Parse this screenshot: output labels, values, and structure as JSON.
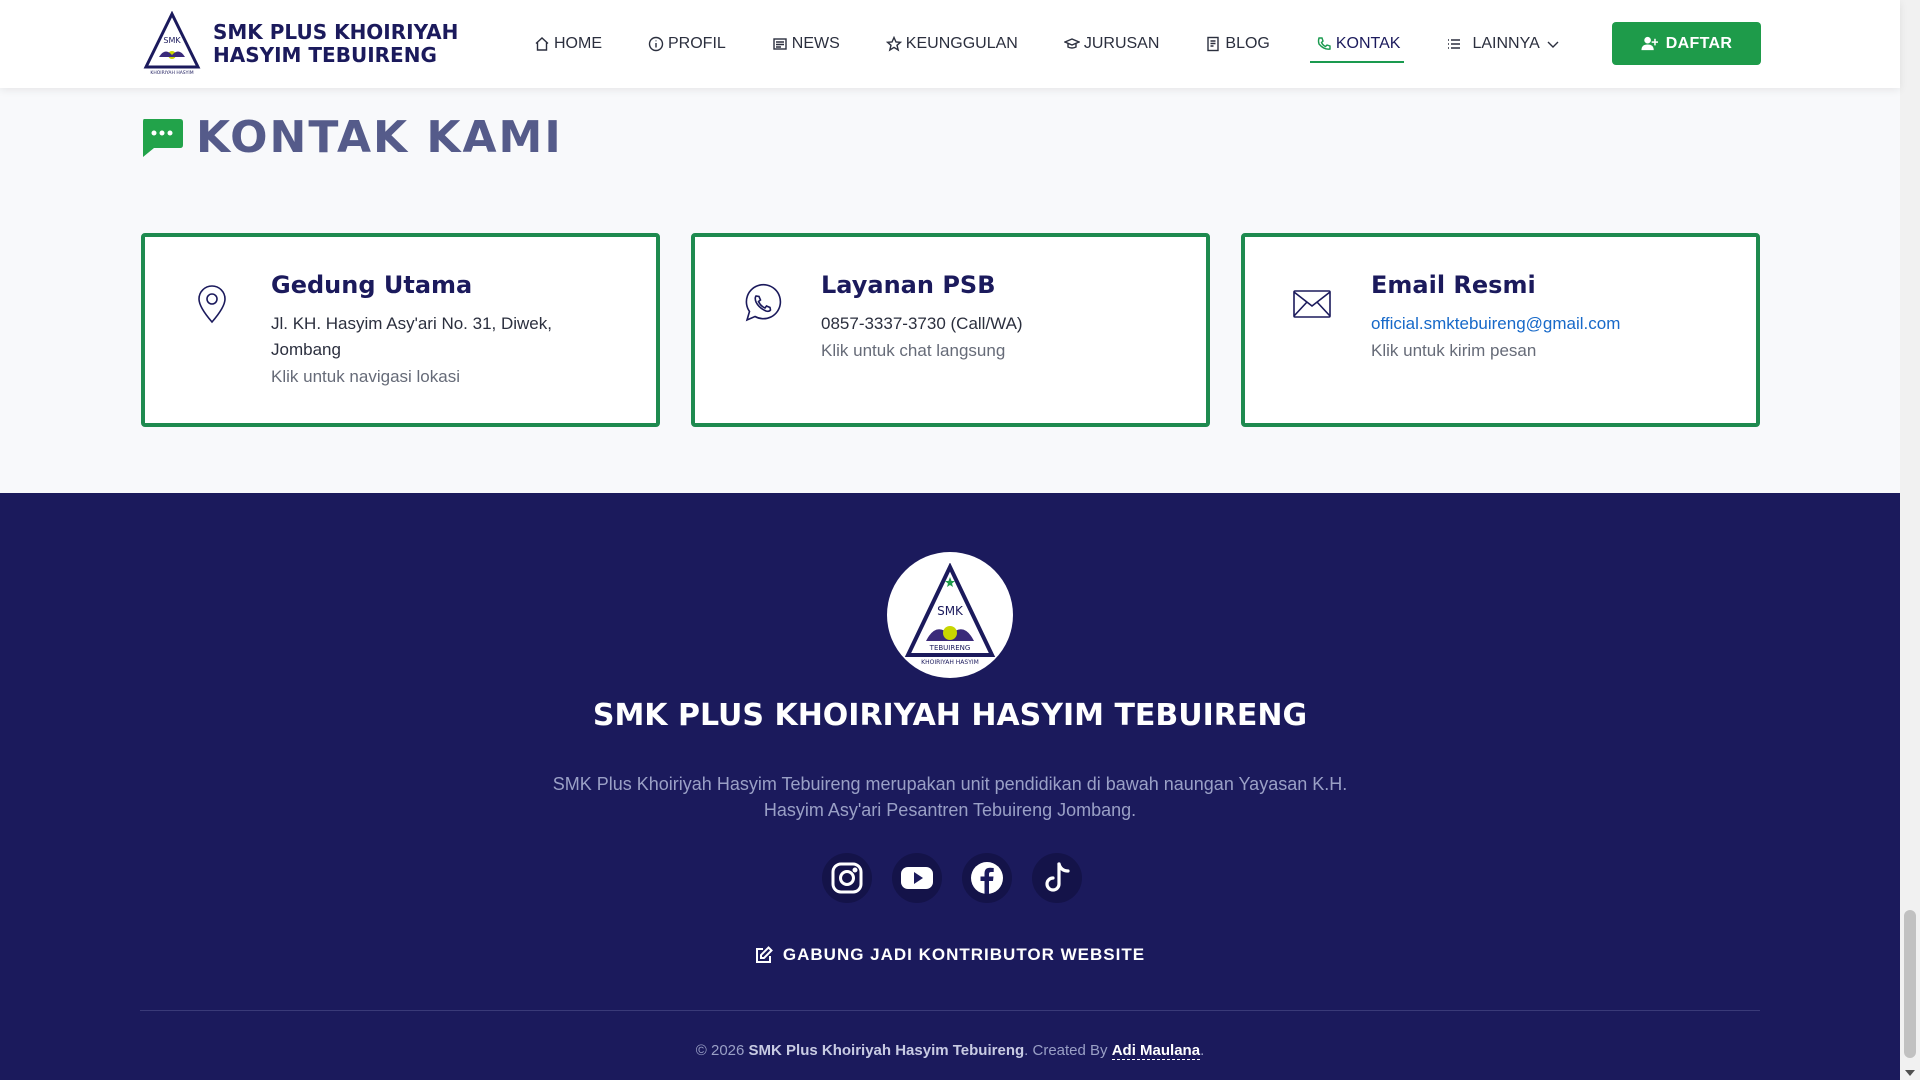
{
  "brand": {
    "name": "SMK PLUS KHOIRIYAH HASYIM TEBUIRENG"
  },
  "nav": {
    "items": [
      {
        "label": "HOME",
        "icon": "home-icon"
      },
      {
        "label": "PROFIL",
        "icon": "info-icon"
      },
      {
        "label": "NEWS",
        "icon": "newspaper-icon"
      },
      {
        "label": "KEUNGGULAN",
        "icon": "star-icon"
      },
      {
        "label": "JURUSAN",
        "icon": "mortarboard-icon"
      },
      {
        "label": "BLOG",
        "icon": "document-icon"
      },
      {
        "label": "KONTAK",
        "icon": "phone-icon",
        "active": true
      },
      {
        "label": "LAINNYA",
        "icon": "list-icon"
      }
    ],
    "cta_label": "DAFTAR"
  },
  "contact": {
    "title": "KONTAK KAMI",
    "cards": [
      {
        "title": "Gedung Utama",
        "detail": "Jl. KH. Hasyim Asy'ari No. 31, Diwek, Jombang",
        "hint": "Klik untuk navigasi lokasi",
        "icon": "location-pin-icon"
      },
      {
        "title": "Layanan PSB",
        "detail": "0857-3337-3730 (Call/WA)",
        "hint": "Klik untuk chat langsung",
        "icon": "whatsapp-icon"
      },
      {
        "title": "Email Resmi",
        "detail": "official.smktebuireng@gmail.com",
        "hint": "Klik untuk kirim pesan",
        "icon": "envelope-icon"
      }
    ]
  },
  "footer": {
    "title": "SMK PLUS KHOIRIYAH HASYIM TEBUIRENG",
    "description": "SMK Plus Khoiriyah Hasyim Tebuireng merupakan unit pendidikan di bawah naungan Yayasan K.H. Hasyim Asy'ari Pesantren Tebuireng Jombang.",
    "socials": [
      "instagram-icon",
      "youtube-icon",
      "facebook-icon",
      "tiktok-icon"
    ],
    "contributor_label": "GABUNG JADI KONTRIBUTOR WEBSITE",
    "copyright_prefix": "© 2026",
    "copyright_org": "SMK Plus Khoiriyah Hasyim Tebuireng",
    "created_by": ". Created By",
    "author": "Adi Maulana",
    "suffix": "."
  },
  "logo_text": {
    "top": "SMK",
    "bottom": "TEBUIRENG",
    "ring": "KHOIRIYAH HASYIM"
  },
  "colors": {
    "primary": "#1b1a5c",
    "accent": "#1e9b4a",
    "link": "#1769c9"
  }
}
